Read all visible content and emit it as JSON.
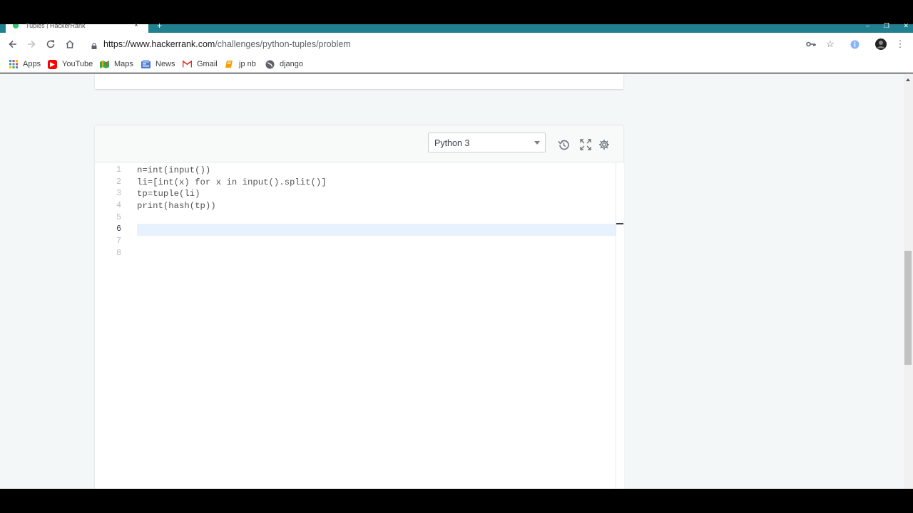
{
  "browser": {
    "tab_title": "Tuples | HackerRank",
    "tab_close": "×",
    "new_tab": "+",
    "url_domain": "https://www.hackerrank.com",
    "url_path": "/challenges/python-tuples/problem",
    "icons": [
      "back-icon",
      "forward-icon",
      "reload-icon",
      "home-icon",
      "lock-icon",
      "key-icon",
      "star-icon",
      "extension-icon",
      "profile-icon",
      "menu-icon"
    ],
    "bookmarks": [
      {
        "label": "Apps",
        "icon": "apps-grid-icon",
        "color": "#4285f4"
      },
      {
        "label": "YouTube",
        "icon": "youtube-icon",
        "color": "#ff0000"
      },
      {
        "label": "Maps",
        "icon": "maps-icon",
        "color": "#34a853"
      },
      {
        "label": "News",
        "icon": "news-icon",
        "color": "#4a7bd0"
      },
      {
        "label": "Gmail",
        "icon": "gmail-icon",
        "color": "#d93025"
      },
      {
        "label": "jp nb",
        "icon": "bookmark-folder-icon",
        "color": "#f4a000"
      },
      {
        "label": "django",
        "icon": "globe-icon",
        "color": "#5f6368"
      }
    ],
    "accent_color": "#20808f"
  },
  "editor": {
    "language": "Python 3",
    "line_numbers": [
      "1",
      "2",
      "3",
      "4",
      "5",
      "6",
      "7",
      "8"
    ],
    "active_line": 6,
    "code": [
      "n=int(input())",
      "li=[int(x) for x in input().split()]",
      "tp=tuple(li)",
      "print(hash(tp))",
      "",
      "",
      "",
      ""
    ]
  }
}
